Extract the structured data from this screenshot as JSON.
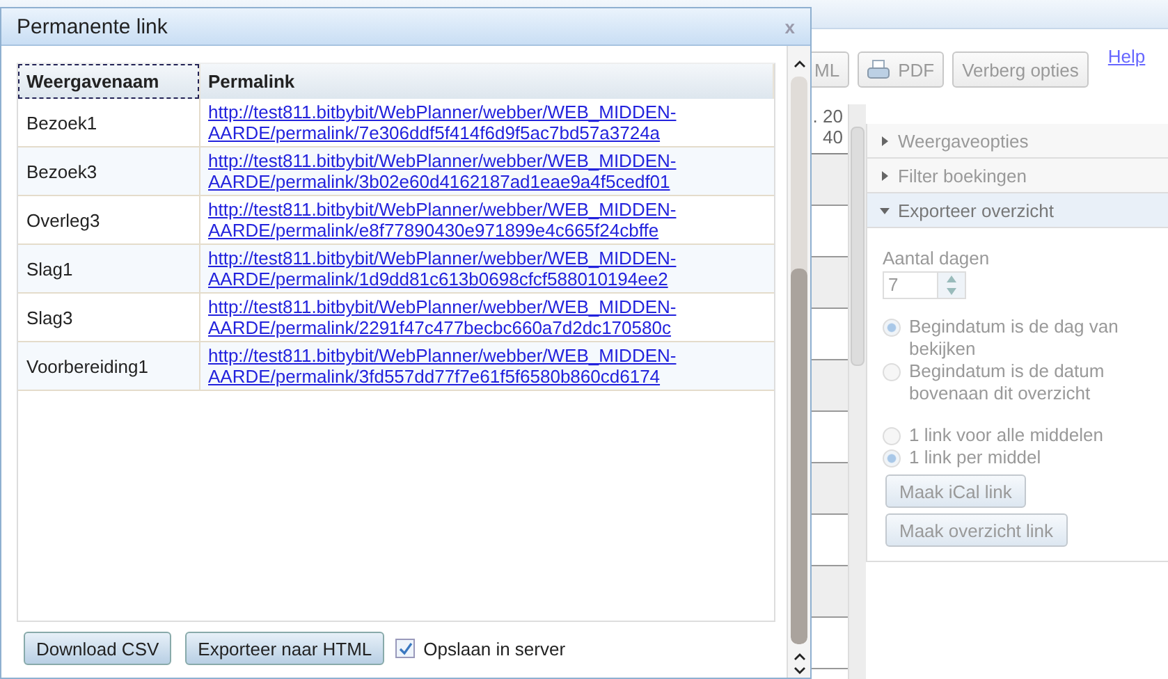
{
  "toolbar": {
    "buttons": [
      {
        "label": "ML",
        "kind": "text"
      },
      {
        "label": "PDF",
        "kind": "pdf"
      },
      {
        "label": "Verberg opties",
        "kind": "text"
      }
    ],
    "help": "Help"
  },
  "grid": {
    "header": [
      ". 20",
      "40"
    ]
  },
  "options_panel": {
    "disabled": true,
    "sections": [
      {
        "title": "Weergaveopties",
        "expanded": false
      },
      {
        "title": "Filter boekingen",
        "expanded": false
      },
      {
        "title": "Exporteer overzicht",
        "expanded": true
      }
    ],
    "days_label": "Aantal dagen",
    "days_value": "7",
    "start_options": [
      {
        "label": "Begindatum is de dag van bekijken",
        "selected": true
      },
      {
        "label": "Begindatum is de datum bovenaan dit overzicht",
        "selected": false
      }
    ],
    "link_options": [
      {
        "label": "1 link voor alle middelen",
        "selected": false
      },
      {
        "label": "1 link per middel",
        "selected": true
      }
    ],
    "buttons": [
      "Maak iCal link",
      "Maak overzicht link"
    ]
  },
  "dialog": {
    "title": "Permanente link",
    "close": "x",
    "columns": [
      "Weergavenaam",
      "Permalink"
    ],
    "rows": [
      {
        "name": "Bezoek1",
        "link": "http://test811.bitbybit/WebPlanner/webber/WEB_MIDDEN-AARDE/permalink/7e306ddf5f414f6d9f5ac7bd57a3724a"
      },
      {
        "name": "Bezoek3",
        "link": "http://test811.bitbybit/WebPlanner/webber/WEB_MIDDEN-AARDE/permalink/3b02e60d4162187ad1eae9a4f5cedf01"
      },
      {
        "name": "Overleg3",
        "link": "http://test811.bitbybit/WebPlanner/webber/WEB_MIDDEN-AARDE/permalink/e8f77890430e971899e4c665f24cbffe"
      },
      {
        "name": "Slag1",
        "link": "http://test811.bitbybit/WebPlanner/webber/WEB_MIDDEN-AARDE/permalink/1d9dd81c613b0698cfcf588010194ee2"
      },
      {
        "name": "Slag3",
        "link": "http://test811.bitbybit/WebPlanner/webber/WEB_MIDDEN-AARDE/permalink/2291f47c477becbc660a7d2dc170580c"
      },
      {
        "name": "Voorbereiding1",
        "link": "http://test811.bitbybit/WebPlanner/webber/WEB_MIDDEN-AARDE/permalink/3fd557dd77f7e61f5f6580b860cd6174"
      }
    ],
    "buttons": [
      "Download CSV",
      "Exporteer naar HTML"
    ],
    "save_checkbox": {
      "label": "Opslaan in server",
      "checked": true
    }
  }
}
